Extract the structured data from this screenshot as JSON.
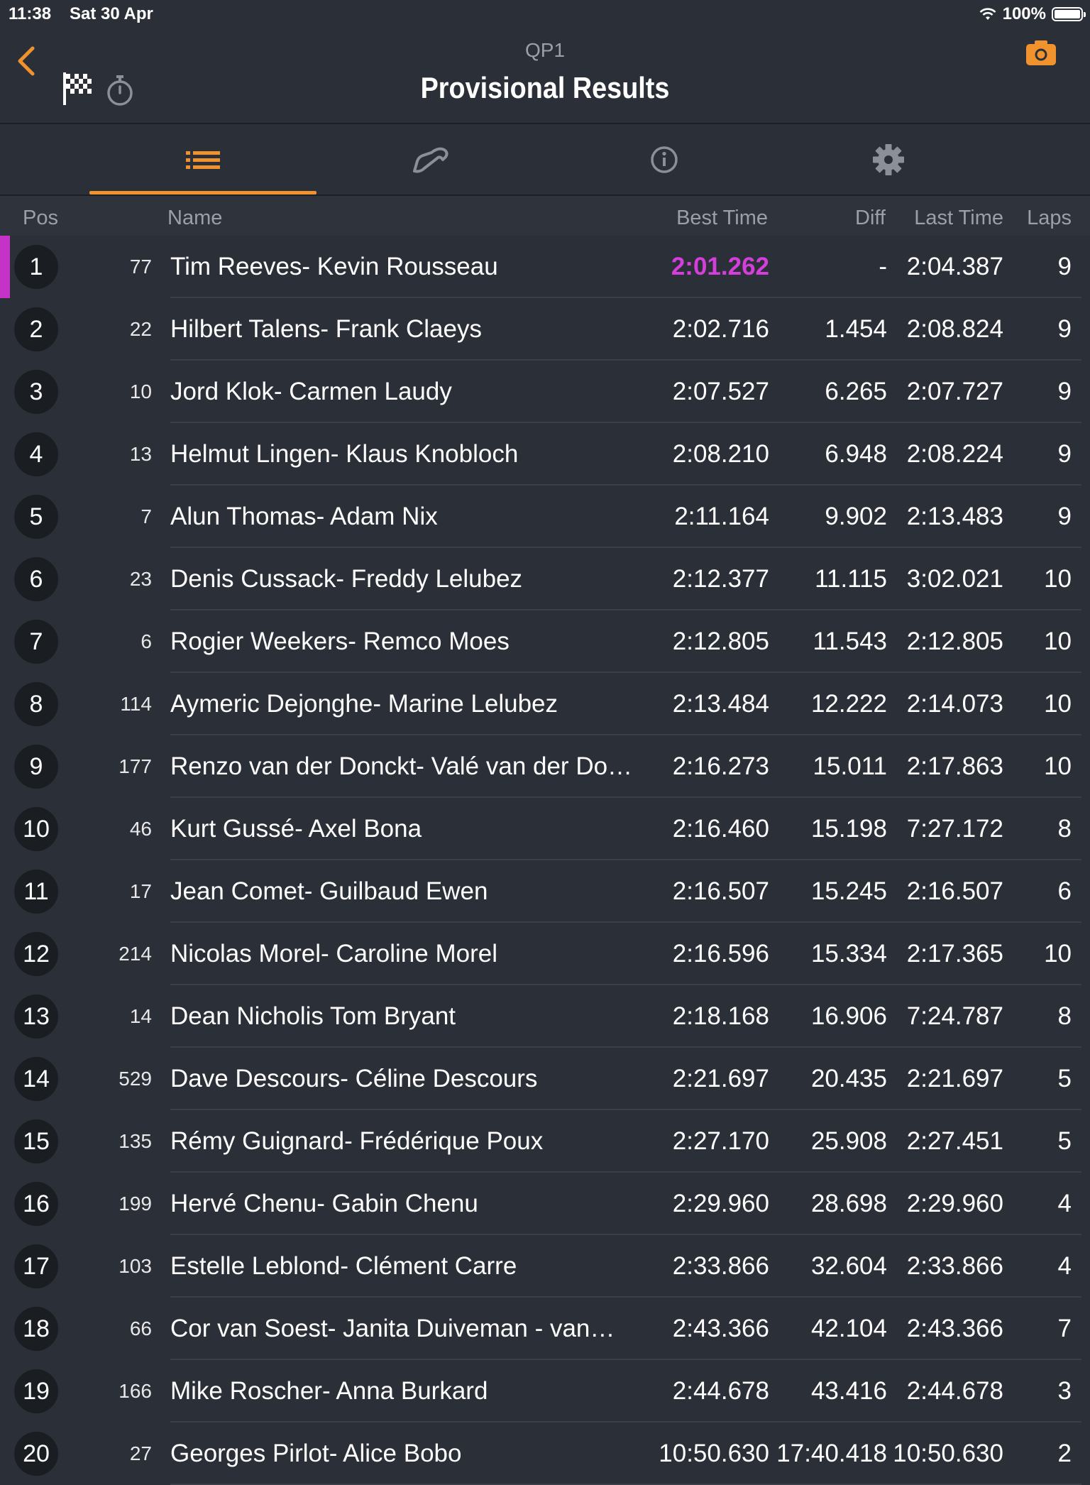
{
  "status_bar": {
    "time": "11:38",
    "date": "Sat 30 Apr",
    "battery": "100%"
  },
  "header": {
    "subtitle": "QP1",
    "title": "Provisional Results"
  },
  "icons": {
    "back": "chevron-left-icon",
    "flag": "checkered-flag-icon",
    "stopwatch": "stopwatch-icon",
    "camera": "camera-icon",
    "tab_list": "list-icon",
    "tab_track": "track-icon",
    "tab_info": "info-icon",
    "tab_settings": "gear-icon"
  },
  "colors": {
    "accent": "#f0922e",
    "fastest": "#d43fdc",
    "background": "#2b2f38"
  },
  "columns": {
    "pos": "Pos",
    "name": "Name",
    "best": "Best Time",
    "diff": "Diff",
    "last": "Last Time",
    "laps": "Laps"
  },
  "rows": [
    {
      "pos": "1",
      "num": "77",
      "name": "Tim Reeves- Kevin Rousseau",
      "best": "2:01.262",
      "diff": "-",
      "last": "2:04.387",
      "laps": "9",
      "fastest": true
    },
    {
      "pos": "2",
      "num": "22",
      "name": "Hilbert Talens- Frank Claeys",
      "best": "2:02.716",
      "diff": "1.454",
      "last": "2:08.824",
      "laps": "9"
    },
    {
      "pos": "3",
      "num": "10",
      "name": "Jord Klok- Carmen Laudy",
      "best": "2:07.527",
      "diff": "6.265",
      "last": "2:07.727",
      "laps": "9"
    },
    {
      "pos": "4",
      "num": "13",
      "name": "Helmut Lingen- Klaus Knobloch",
      "best": "2:08.210",
      "diff": "6.948",
      "last": "2:08.224",
      "laps": "9"
    },
    {
      "pos": "5",
      "num": "7",
      "name": "Alun Thomas- Adam Nix",
      "best": "2:11.164",
      "diff": "9.902",
      "last": "2:13.483",
      "laps": "9"
    },
    {
      "pos": "6",
      "num": "23",
      "name": "Denis Cussack- Freddy Lelubez",
      "best": "2:12.377",
      "diff": "11.115",
      "last": "3:02.021",
      "laps": "10"
    },
    {
      "pos": "7",
      "num": "6",
      "name": "Rogier Weekers- Remco Moes",
      "best": "2:12.805",
      "diff": "11.543",
      "last": "2:12.805",
      "laps": "10"
    },
    {
      "pos": "8",
      "num": "114",
      "name": "Aymeric Dejonghe- Marine Lelubez",
      "best": "2:13.484",
      "diff": "12.222",
      "last": "2:14.073",
      "laps": "10"
    },
    {
      "pos": "9",
      "num": "177",
      "name": "Renzo van der Donckt- Valé van der Do…",
      "best": "2:16.273",
      "diff": "15.011",
      "last": "2:17.863",
      "laps": "10"
    },
    {
      "pos": "10",
      "num": "46",
      "name": "Kurt Gussé- Axel Bona",
      "best": "2:16.460",
      "diff": "15.198",
      "last": "7:27.172",
      "laps": "8"
    },
    {
      "pos": "11",
      "num": "17",
      "name": "Jean Comet- Guilbaud Ewen",
      "best": "2:16.507",
      "diff": "15.245",
      "last": "2:16.507",
      "laps": "6"
    },
    {
      "pos": "12",
      "num": "214",
      "name": "Nicolas Morel- Caroline Morel",
      "best": "2:16.596",
      "diff": "15.334",
      "last": "2:17.365",
      "laps": "10"
    },
    {
      "pos": "13",
      "num": "14",
      "name": "Dean Nicholis Tom Bryant",
      "best": "2:18.168",
      "diff": "16.906",
      "last": "7:24.787",
      "laps": "8"
    },
    {
      "pos": "14",
      "num": "529",
      "name": "Dave Descours- Céline Descours",
      "best": "2:21.697",
      "diff": "20.435",
      "last": "2:21.697",
      "laps": "5"
    },
    {
      "pos": "15",
      "num": "135",
      "name": "Rémy Guignard- Frédérique Poux",
      "best": "2:27.170",
      "diff": "25.908",
      "last": "2:27.451",
      "laps": "5"
    },
    {
      "pos": "16",
      "num": "199",
      "name": "Hervé Chenu- Gabin Chenu",
      "best": "2:29.960",
      "diff": "28.698",
      "last": "2:29.960",
      "laps": "4"
    },
    {
      "pos": "17",
      "num": "103",
      "name": "Estelle Leblond- Clément Carre",
      "best": "2:33.866",
      "diff": "32.604",
      "last": "2:33.866",
      "laps": "4"
    },
    {
      "pos": "18",
      "num": "66",
      "name": "Cor van Soest- Janita Duiveman - van…",
      "best": "2:43.366",
      "diff": "42.104",
      "last": "2:43.366",
      "laps": "7"
    },
    {
      "pos": "19",
      "num": "166",
      "name": "Mike Roscher- Anna Burkard",
      "best": "2:44.678",
      "diff": "43.416",
      "last": "2:44.678",
      "laps": "3"
    },
    {
      "pos": "20",
      "num": "27",
      "name": "Georges Pirlot- Alice Bobo",
      "best": "10:50.630",
      "diff": "17:40.418",
      "last": "10:50.630",
      "laps": "2"
    }
  ]
}
